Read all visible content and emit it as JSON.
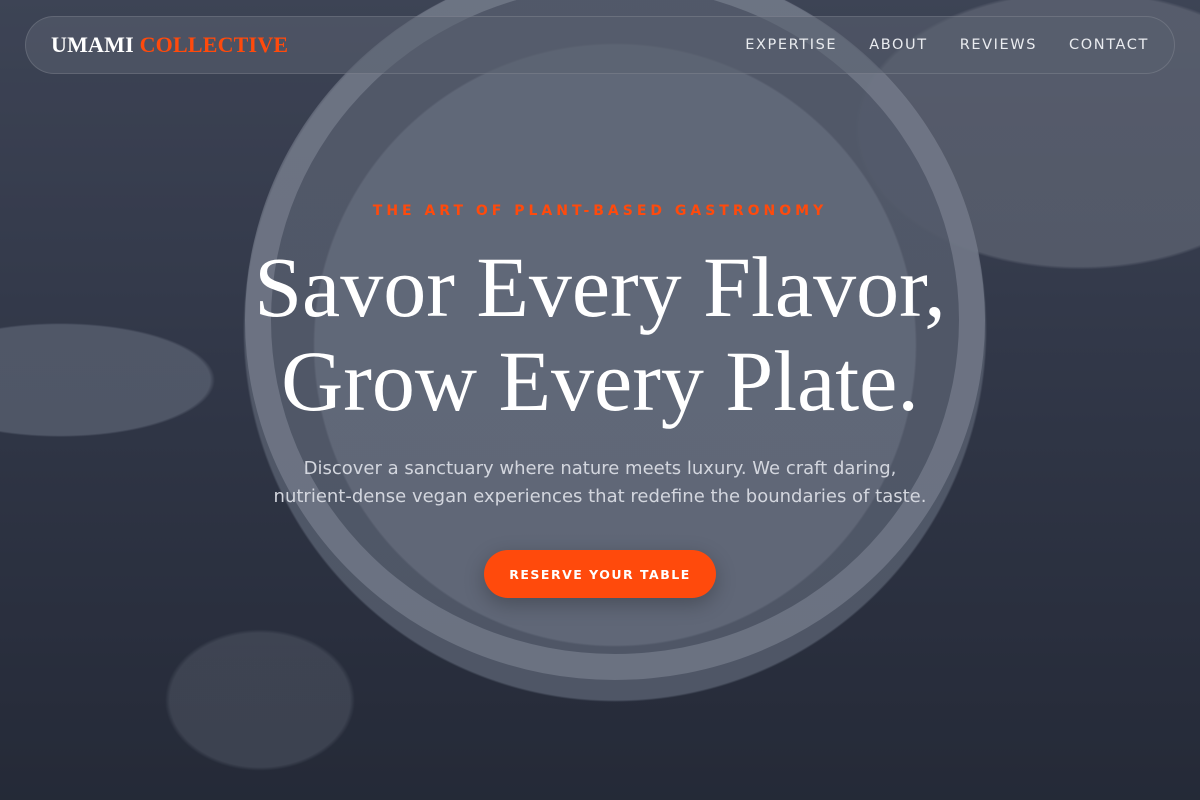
{
  "brand": {
    "primary": "UMAMI",
    "accent": "COLLECTIVE",
    "accent_color": "#ff4a0c"
  },
  "nav": {
    "items": [
      {
        "label": "EXPERTISE"
      },
      {
        "label": "ABOUT"
      },
      {
        "label": "REVIEWS"
      },
      {
        "label": "CONTACT"
      }
    ]
  },
  "hero": {
    "eyebrow": "THE ART OF PLANT-BASED GASTRONOMY",
    "headline_line1": "Savor Every Flavor,",
    "headline_line2": "Grow Every Plate.",
    "subtext_line1": "Discover a sanctuary where nature meets luxury. We craft daring,",
    "subtext_line2": "nutrient-dense vegan experiences that redefine the boundaries of taste.",
    "cta_label": "RESERVE YOUR TABLE"
  }
}
